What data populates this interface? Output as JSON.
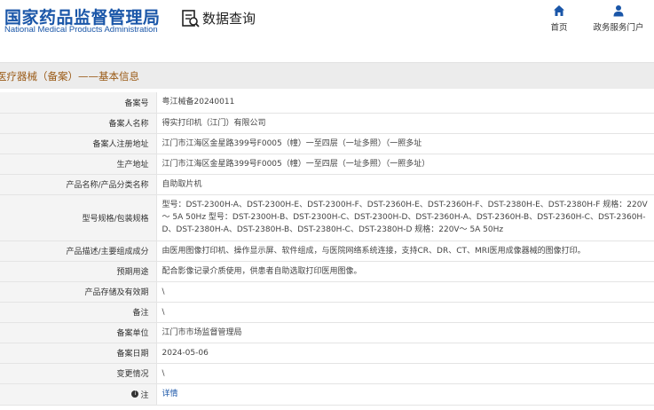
{
  "header": {
    "logo_cn": "国家药品监督管理局",
    "logo_en": "National Medical Products Administration",
    "query_icon": "search-document-icon",
    "query_label": "数据查询",
    "nav": {
      "home_label": "首页",
      "home_icon": "home-icon",
      "portal_label": "政务服务门户",
      "portal_icon": "user-icon"
    }
  },
  "section": {
    "title": "医疗器械（备案）——基本信息"
  },
  "rows": [
    {
      "label": "备案号",
      "value": "粤江械备20240011"
    },
    {
      "label": "备案人名称",
      "value": "得实打印机（江门）有限公司"
    },
    {
      "label": "备案人注册地址",
      "value": "江门市江海区金星路399号F0005（幢）一至四层（一址多照）（一照多址"
    },
    {
      "label": "生产地址",
      "value": "江门市江海区金星路399号F0005（幢）一至四层（一址多照）（一照多址）"
    },
    {
      "label": "产品名称/产品分类名称",
      "value": "自助取片机"
    },
    {
      "label": "型号规格/包装规格",
      "value": "型号：DST-2300H-A、DST-2300H-E、DST-2300H-F、DST-2360H-E、DST-2360H-F、DST-2380H-E、DST-2380H-F 规格：220V～ 5A 50Hz 型号：DST-2300H-B、DST-2300H-C、DST-2300H-D、DST-2360H-A、DST-2360H-B、DST-2360H-C、DST-2360H-D、DST-2380H-A、DST-2380H-B、DST-2380H-C、DST-2380H-D 规格：220V～ 5A 50Hz"
    },
    {
      "label": "产品描述/主要组成成分",
      "value": "由医用图像打印机、操作显示屏、软件组成，与医院网络系统连接，支持CR、DR、CT、MRI医用成像器械的图像打印。"
    },
    {
      "label": "预期用途",
      "value": "配合影像记录介质使用，供患者自助选取打印医用图像。"
    },
    {
      "label": "产品存储及有效期",
      "value": "\\"
    },
    {
      "label": "备注",
      "value": "\\"
    },
    {
      "label": "备案单位",
      "value": "江门市市场监督管理局"
    },
    {
      "label": "备案日期",
      "value": "2024-05-06"
    },
    {
      "label": "变更情况",
      "value": "\\"
    },
    {
      "label": "注",
      "value": "详情",
      "icon": "info-icon"
    }
  ]
}
